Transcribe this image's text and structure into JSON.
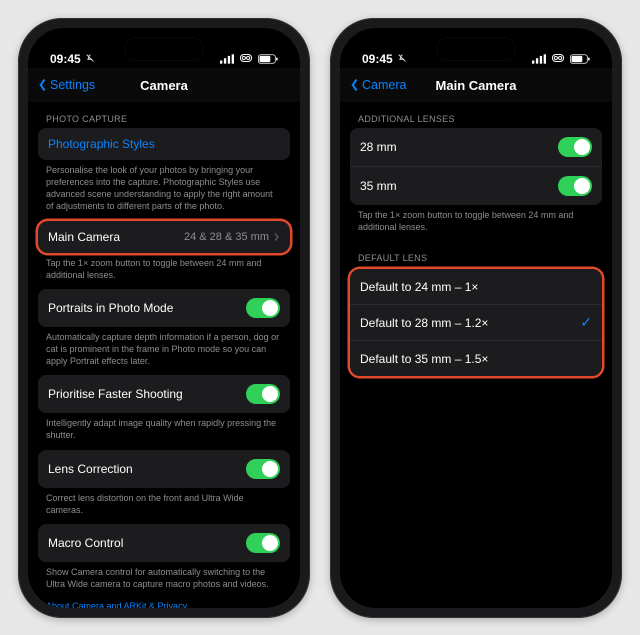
{
  "status": {
    "time": "09:45"
  },
  "phone1": {
    "nav_back": "Settings",
    "nav_title": "Camera",
    "section_photo_capture": "PHOTO CAPTURE",
    "cell_photographic_styles": "Photographic Styles",
    "footer_photographic_styles": "Personalise the look of your photos by bringing your preferences into the capture. Photographic Styles use advanced scene understanding to apply the right amount of adjustments to different parts of the photo.",
    "cell_main_camera_label": "Main Camera",
    "cell_main_camera_detail": "24 & 28 & 35 mm",
    "footer_main_camera": "Tap the 1× zoom button to toggle between 24 mm and additional lenses.",
    "cell_portraits": "Portraits in Photo Mode",
    "footer_portraits": "Automatically capture depth information if a person, dog or cat is prominent in the frame in Photo mode so you can apply Portrait effects later.",
    "cell_prioritise": "Prioritise Faster Shooting",
    "footer_prioritise": "Intelligently adapt image quality when rapidly pressing the shutter.",
    "cell_lens_correction": "Lens Correction",
    "footer_lens_correction": "Correct lens distortion on the front and Ultra Wide cameras.",
    "cell_macro": "Macro Control",
    "footer_macro": "Show Camera control for automatically switching to the Ultra Wide camera to capture macro photos and videos.",
    "about_link": "About Camera and ARKit & Privacy…"
  },
  "phone2": {
    "nav_back": "Camera",
    "nav_title": "Main Camera",
    "section_additional": "ADDITIONAL LENSES",
    "row_28": "28 mm",
    "row_35": "35 mm",
    "footer_additional": "Tap the 1× zoom button to toggle between 24 mm and additional lenses.",
    "section_default": "DEFAULT LENS",
    "default_options": [
      "Default to 24 mm – 1×",
      "Default to 28 mm – 1.2×",
      "Default to 35 mm – 1.5×"
    ],
    "selected_index": 1
  }
}
